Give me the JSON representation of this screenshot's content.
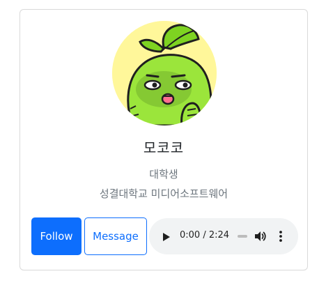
{
  "profile": {
    "name": "모코코",
    "role": "대학생",
    "school": "성결대학교 미디어소프트웨어"
  },
  "actions": {
    "follow_label": "Follow",
    "message_label": "Message"
  },
  "audio": {
    "current_time": "0:00",
    "separator": "/",
    "duration": "2:24",
    "progress": 0
  },
  "colors": {
    "primary": "#0d6efd",
    "avatar_background": "#fff79a",
    "character_green": "#8fe03a",
    "muted_text": "#6c757d"
  },
  "icons": {
    "play": "play-icon",
    "volume": "volume-icon",
    "more": "more-vertical-icon"
  }
}
